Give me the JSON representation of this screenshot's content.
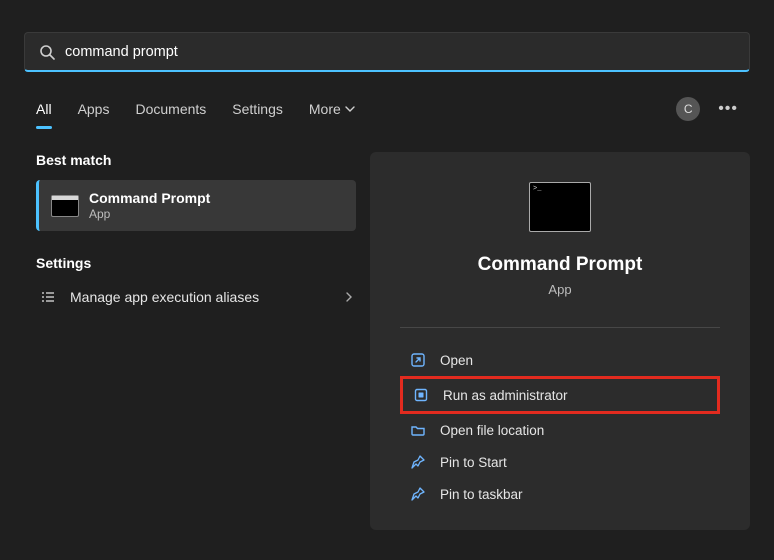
{
  "search": {
    "value": "command prompt"
  },
  "tabs": {
    "all": "All",
    "apps": "Apps",
    "documents": "Documents",
    "settings": "Settings",
    "more": "More"
  },
  "avatar_initial": "C",
  "left": {
    "best_header": "Best match",
    "best_title": "Command Prompt",
    "best_sub": "App",
    "settings_header": "Settings",
    "settings_item": "Manage app execution aliases"
  },
  "preview": {
    "title": "Command Prompt",
    "sub": "App"
  },
  "actions": {
    "open": "Open",
    "run_admin": "Run as administrator",
    "open_loc": "Open file location",
    "pin_start": "Pin to Start",
    "pin_taskbar": "Pin to taskbar"
  },
  "colors": {
    "accent": "#4cc2ff",
    "highlight": "#e22b1f"
  }
}
